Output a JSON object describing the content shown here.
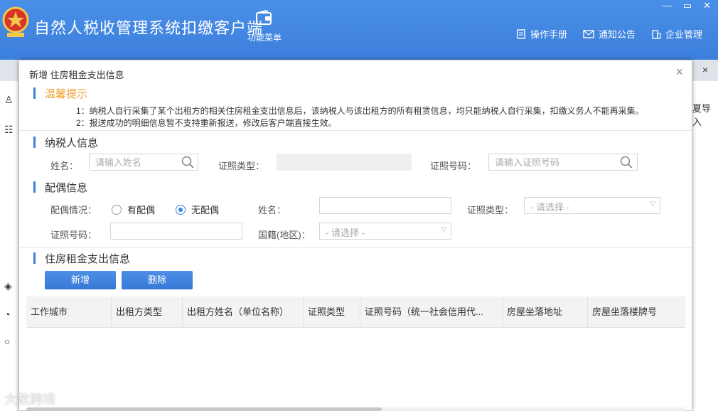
{
  "app": {
    "title": "自然人税收管理系统扣缴客户端",
    "func_menu_label": "功能菜单",
    "actions": [
      {
        "label": "操作手册",
        "icon": "manual-icon"
      },
      {
        "label": "通知公告",
        "icon": "mail-icon"
      },
      {
        "label": "企业管理",
        "icon": "building-icon"
      }
    ],
    "bg_close": "×",
    "bg_right_text": "夏导入"
  },
  "modal": {
    "title": "新增 住房租金支出信息",
    "close": "×",
    "tips": {
      "title": "温馨提示",
      "lines": [
        "1：纳税人自行采集了某个出租方的相关住房租金支出信息后，该纳税人与该出租方的所有租赁信息，均只能纳税人自行采集，扣缴义务人不能再采集。",
        "2：报送成功的明细信息暂不支持重新报送，修改后客户端直接生效。"
      ]
    },
    "taxpayer": {
      "title": "纳税人信息",
      "name_label": "姓名：",
      "name_placeholder": "请输入姓名",
      "id_type_label": "证照类型：",
      "id_no_label": "证照号码：",
      "id_no_placeholder": "请输入证照号码"
    },
    "spouse": {
      "title": "配偶信息",
      "status_label": "配偶情况：",
      "opt_has": "有配偶",
      "opt_none": "无配偶",
      "selected": "无配偶",
      "name_label": "姓名：",
      "id_type_label": "证照类型：",
      "id_type_value": "- 请选择 -",
      "id_no_label": "证照号码：",
      "nationality_label": "国籍(地区)：",
      "nationality_value": "- 请选择 -"
    },
    "rent": {
      "title": "住房租金支出信息",
      "add_label": "新增",
      "delete_label": "删除",
      "columns": [
        "工作城市",
        "出租方类型",
        "出租方姓名（单位名称）",
        "证照类型",
        "证照号码（统一社会信用代...",
        "房屋坐落地址",
        "房屋坐落楼牌号"
      ]
    }
  },
  "watermark": "大数跨境",
  "colors": {
    "header": "#3b7fdc",
    "accent": "#3b7fdc",
    "tip": "#f0a030"
  }
}
